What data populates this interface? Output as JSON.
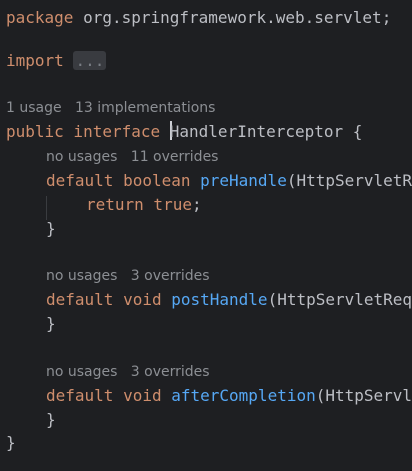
{
  "code": {
    "package_keyword": "package",
    "package_name": " org.springframework.web.servlet;",
    "import_keyword": "import",
    "import_fold": "...",
    "interface_hint": {
      "usages": "1 usage",
      "implementations": "13 implementations"
    },
    "interface_decl": {
      "modifiers": "public interface ",
      "name": "HandlerInterceptor",
      "brace": " {"
    },
    "methods": [
      {
        "hint_usages": "no usages",
        "hint_overrides": "11 overrides",
        "keywords": "default boolean ",
        "name": "preHandle",
        "params": "(HttpServletRequest"
      },
      {
        "hint_usages": "no usages",
        "hint_overrides": "3 overrides",
        "keywords": "default void ",
        "name": "postHandle",
        "params": "(HttpServletRequest"
      },
      {
        "hint_usages": "no usages",
        "hint_overrides": "3 overrides",
        "keywords": "default void ",
        "name": "afterCompletion",
        "params": "(HttpServletRequest"
      }
    ],
    "return_stmt": {
      "keyword": "return",
      "value": " true",
      "semicolon": ";"
    },
    "close_brace": "}",
    "colors": {
      "background": "#1e1f22",
      "keyword": "#cf8e6d",
      "identifier": "#bcbec4",
      "method": "#56a8f5",
      "hint": "#8c8f94"
    }
  }
}
